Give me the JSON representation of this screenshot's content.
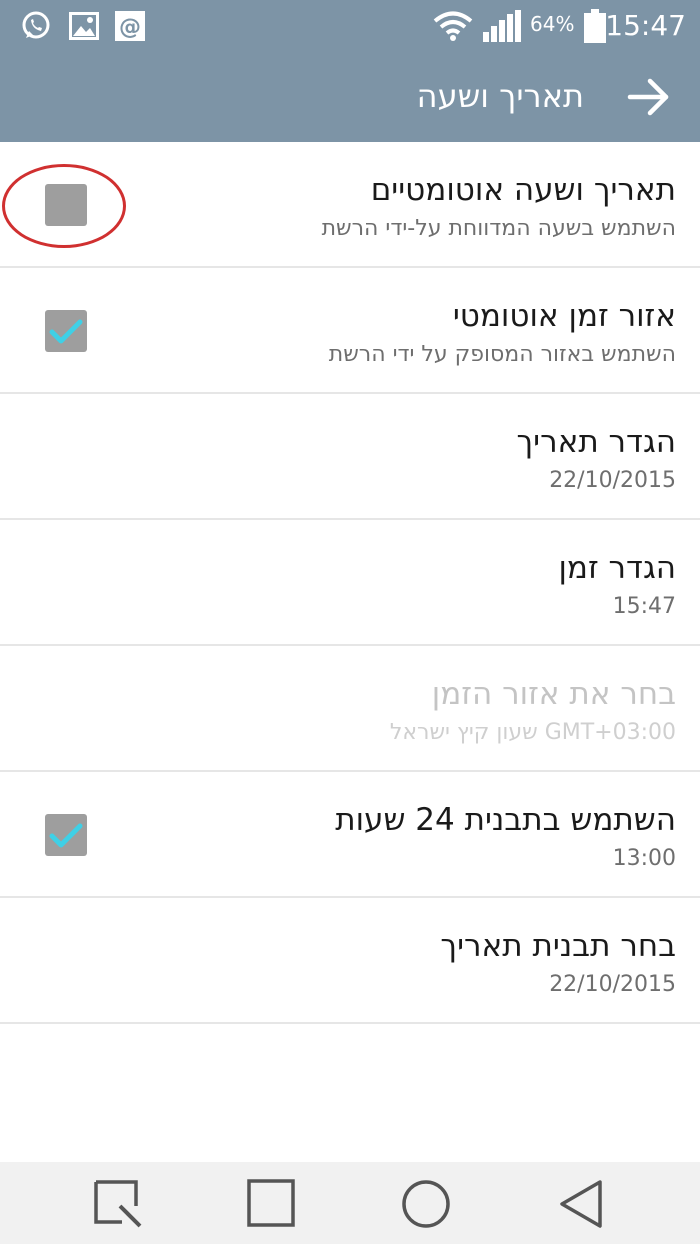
{
  "status_bar": {
    "time": "15:47",
    "battery_percent": "64%",
    "icons": [
      "whatsapp-icon",
      "gallery-icon",
      "email-icon",
      "wifi-icon",
      "signal-icon",
      "battery-icon"
    ]
  },
  "app_bar": {
    "title": "תאריך ושעה",
    "back_icon": "arrow-right-icon"
  },
  "settings": [
    {
      "title": "תאריך ושעה אוטומטיים",
      "subtitle": "השתמש בשעה המדווחת על-ידי הרשת",
      "checkbox": "unchecked"
    },
    {
      "title": "אזור זמן אוטומטי",
      "subtitle": "השתמש באזור המסופק על ידי הרשת",
      "checkbox": "checked"
    },
    {
      "title": "הגדר תאריך",
      "subtitle": "22/10/2015"
    },
    {
      "title": "הגדר זמן",
      "subtitle": "15:47"
    },
    {
      "title": "בחר את אזור הזמן",
      "subtitle": "GMT+03:00 שעון קיץ ישראל",
      "disabled": true
    },
    {
      "title": "השתמש בתבנית 24 שעות",
      "subtitle": "13:00",
      "checkbox": "checked"
    },
    {
      "title": "בחר תבנית תאריך",
      "subtitle": "22/10/2015"
    }
  ],
  "nav_bar": {
    "icons": [
      "recent-apps-icon",
      "home-icon",
      "assistant-circle-icon",
      "back-triangle-icon"
    ]
  },
  "colors": {
    "header_bg": "#7d94a6",
    "check_accent": "#3fd0e6",
    "annotation_red": "#d03030"
  }
}
